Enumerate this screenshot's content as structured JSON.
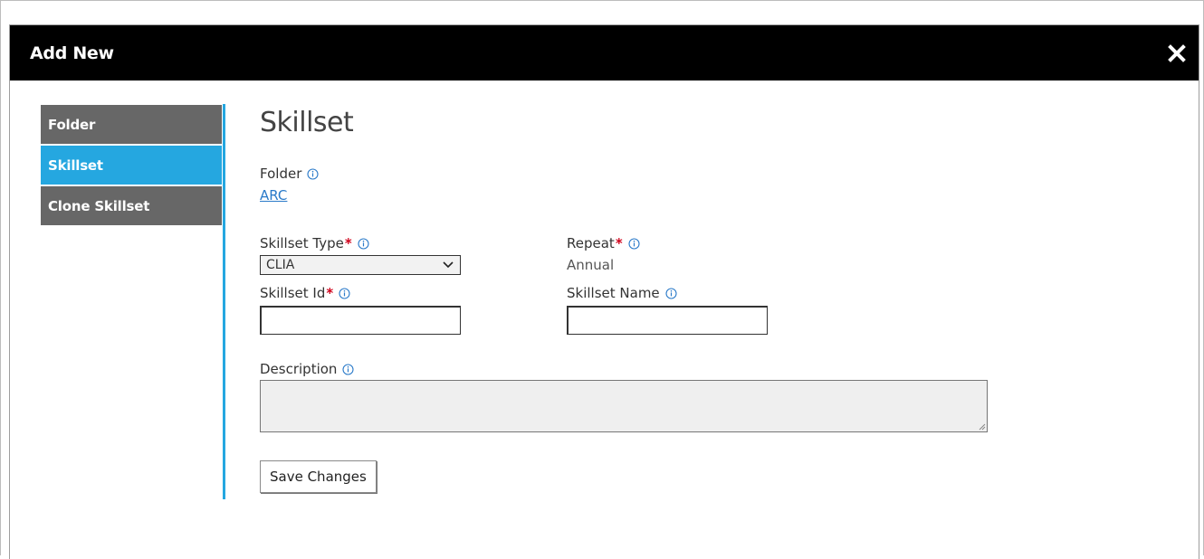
{
  "dialog": {
    "title": "Add New"
  },
  "sidebar": {
    "items": [
      {
        "label": "Folder"
      },
      {
        "label": "Skillset"
      },
      {
        "label": "Clone Skillset"
      }
    ]
  },
  "form": {
    "heading": "Skillset",
    "folder_label": "Folder",
    "folder_value": "ARC",
    "skillset_type_label": "Skillset Type",
    "skillset_type_value": "CLIA",
    "repeat_label": "Repeat",
    "repeat_value": "Annual",
    "skillset_id_label": "Skillset Id",
    "skillset_id_value": "",
    "skillset_name_label": "Skillset Name",
    "skillset_name_value": "",
    "description_label": "Description",
    "description_value": "",
    "required_marker": "*",
    "save_label": "Save Changes"
  },
  "colors": {
    "titlebar": "#000000",
    "sidebar_item": "#676767",
    "sidebar_active": "#25a7e0",
    "required": "#d0021b",
    "link": "#2a7ac9",
    "info_icon": "#2a7ac9"
  },
  "icons": [
    "close-icon",
    "info-icon",
    "chevron-down-icon",
    "resize-grip-icon"
  ]
}
